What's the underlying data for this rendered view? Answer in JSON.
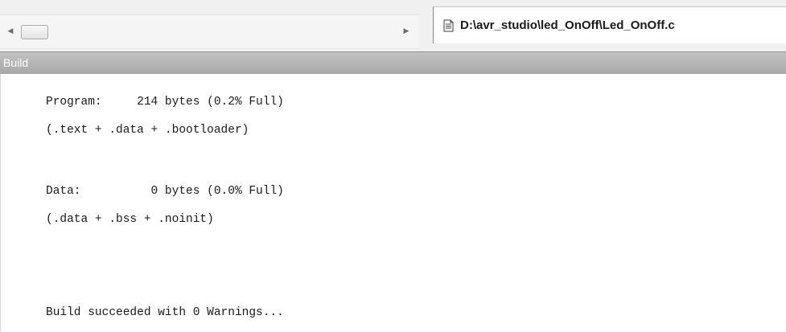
{
  "window": {
    "tab_file_path": "D:\\avr_studio\\led_OnOff\\Led_OnOff.c",
    "file_icon": "document-icon"
  },
  "scrollbar": {
    "left_arrow": "◀",
    "right_arrow": "▶"
  },
  "build_panel": {
    "title": "Build",
    "output_lines": [
      "Program:     214 bytes (0.2% Full)",
      "(.text + .data + .bootloader)",
      "Data:          0 bytes (0.0% Full)",
      "(.data + .bss + .noinit)",
      "Build succeeded with 0 Warnings..."
    ]
  },
  "colors": {
    "header_bg": "#b4b4b4",
    "header_text": "#ffffff",
    "output_text": "#1a1a1a"
  }
}
